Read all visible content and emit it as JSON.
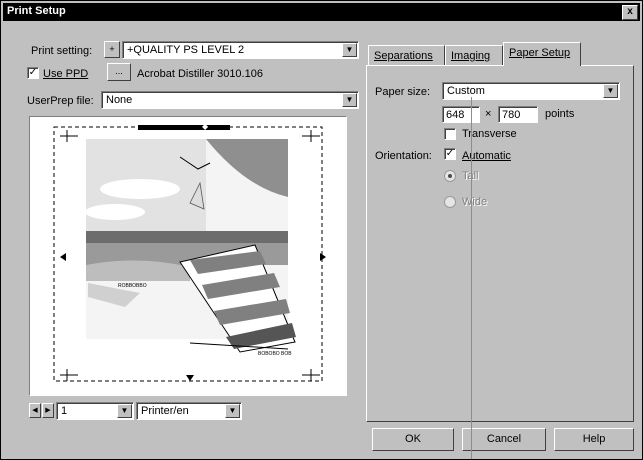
{
  "window": {
    "title": "Print Setup",
    "close_glyph": "x"
  },
  "left": {
    "print_setting": {
      "label": "Print setting:",
      "value": "+QUALITY PS LEVEL 2"
    },
    "use_ppd": {
      "label": "Use PPD",
      "checked": true,
      "checkmark": "✓"
    },
    "ppd_button": "...",
    "ppd_name": "Acrobat Distiller 3010.106",
    "user_prep": {
      "label": "UserPrep file:",
      "value": "None"
    },
    "preview": {
      "crop_mark": "◆",
      "caption_left": "ROBBOBBO",
      "caption_right": "BOBOBO BOB"
    },
    "page_buttons": [
      "◀",
      "▶"
    ],
    "page_value": "1",
    "page_mode": "Printer/en"
  },
  "tabs": [
    {
      "label": "Separations",
      "active": false
    },
    {
      "label": "Imaging",
      "active": false
    },
    {
      "label": "Paper Setup",
      "active": true
    }
  ],
  "paper_setup": {
    "paper_size_label": "Paper size:",
    "paper_size_value": "Custom",
    "width": "648",
    "times": "×",
    "height": "780",
    "units": "points",
    "transverse_label": "Transverse",
    "orientation_label": "Orientation:",
    "automatic_label": "Automatic",
    "tall_label": "Tall",
    "wide_label": "Wide"
  },
  "footer": {
    "ok": "OK",
    "cancel": "Cancel",
    "help": "Help"
  },
  "colors": {
    "title_bg": "#000000",
    "face": "#c0c0c0",
    "guide_line": "#33cc33"
  }
}
